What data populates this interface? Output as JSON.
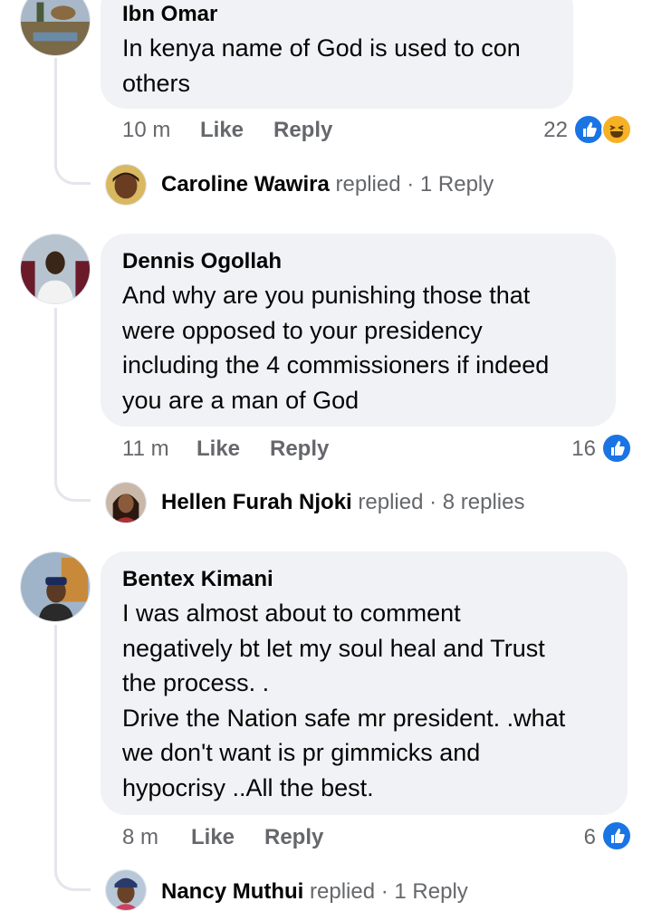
{
  "comments": [
    {
      "author": "Ibn Omar",
      "lines": [
        "In kenya name of God is used to con",
        "others"
      ],
      "time": "10 m",
      "like": "Like",
      "reply": "Reply",
      "reaction_count": "22",
      "reactions": [
        "like-icon",
        "haha-icon"
      ],
      "replied": {
        "name": "Caroline Wawira",
        "verb": "replied",
        "sep": "·",
        "count": "1 Reply"
      }
    },
    {
      "author": "Dennis Ogollah",
      "lines": [
        "And why are you punishing those that",
        "were opposed to your presidency",
        "including the 4 commissioners if indeed",
        "you are a man of God"
      ],
      "time": "11 m",
      "like": "Like",
      "reply": "Reply",
      "reaction_count": "16",
      "reactions": [
        "like-icon"
      ],
      "replied": {
        "name": "Hellen Furah Njoki",
        "verb": "replied",
        "sep": "·",
        "count": "8 replies"
      }
    },
    {
      "author": "Bentex Kimani",
      "lines": [
        "I was almost about to comment",
        "negatively bt let my soul heal and Trust",
        "the process. .",
        "Drive the Nation safe mr president. .what",
        "we don't want is pr gimmicks and",
        "hypocrisy ..All the best."
      ],
      "time": "8 m",
      "like": "Like",
      "reply": "Reply",
      "reaction_count": "6",
      "reactions": [
        "like-icon"
      ],
      "replied": {
        "name": "Nancy Muthui",
        "verb": "replied",
        "sep": "·",
        "count": "1 Reply"
      }
    }
  ],
  "colors": {
    "bubble": "#f0f2f5",
    "secondary_text": "#65676b",
    "like_blue": "#1b74e4",
    "haha_yellow": "#f7b125",
    "thread_line": "#e4e6eb"
  }
}
